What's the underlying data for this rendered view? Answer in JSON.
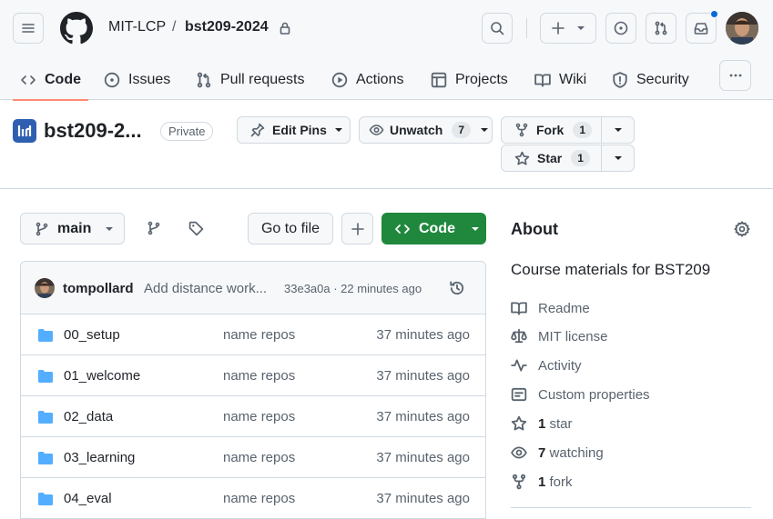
{
  "header": {
    "org": "MIT-LCP",
    "separator": "/",
    "repo": "bst209-2024",
    "notification_dot_color": "#0969da"
  },
  "tabs": [
    {
      "label": "Code",
      "icon": "code-icon",
      "active": true
    },
    {
      "label": "Issues",
      "icon": "issue-icon"
    },
    {
      "label": "Pull requests",
      "icon": "pull-request-icon"
    },
    {
      "label": "Actions",
      "icon": "play-icon"
    },
    {
      "label": "Projects",
      "icon": "table-icon"
    },
    {
      "label": "Wiki",
      "icon": "book-icon"
    },
    {
      "label": "Security",
      "icon": "shield-icon"
    }
  ],
  "repo_head": {
    "title": "bst209-2...",
    "visibility": "Private",
    "edit_pins": "Edit Pins",
    "unwatch": "Unwatch",
    "unwatch_count": "7",
    "fork": "Fork",
    "fork_count": "1",
    "star": "Star",
    "star_count": "1"
  },
  "toolbar": {
    "branch": "main",
    "go_to_file": "Go to file",
    "add": "+",
    "code": "Code",
    "code_color": "#1f883d"
  },
  "commit": {
    "author": "tompollard",
    "message": "Add distance work...",
    "hash_time": "33e3a0a · 22 minutes ago"
  },
  "files": [
    {
      "name": "00_setup",
      "message": "name repos",
      "time": "37 minutes ago"
    },
    {
      "name": "01_welcome",
      "message": "name repos",
      "time": "37 minutes ago"
    },
    {
      "name": "02_data",
      "message": "name repos",
      "time": "37 minutes ago"
    },
    {
      "name": "03_learning",
      "message": "name repos",
      "time": "37 minutes ago"
    },
    {
      "name": "04_eval",
      "message": "name repos",
      "time": "37 minutes ago"
    }
  ],
  "about": {
    "heading": "About",
    "description": "Course materials for BST209",
    "readme": "Readme",
    "license": "MIT license",
    "activity": "Activity",
    "custom_properties": "Custom properties",
    "stars_count": "1",
    "stars_label": "star",
    "watching_count": "7",
    "watching_label": "watching",
    "forks_count": "1",
    "forks_label": "fork"
  }
}
